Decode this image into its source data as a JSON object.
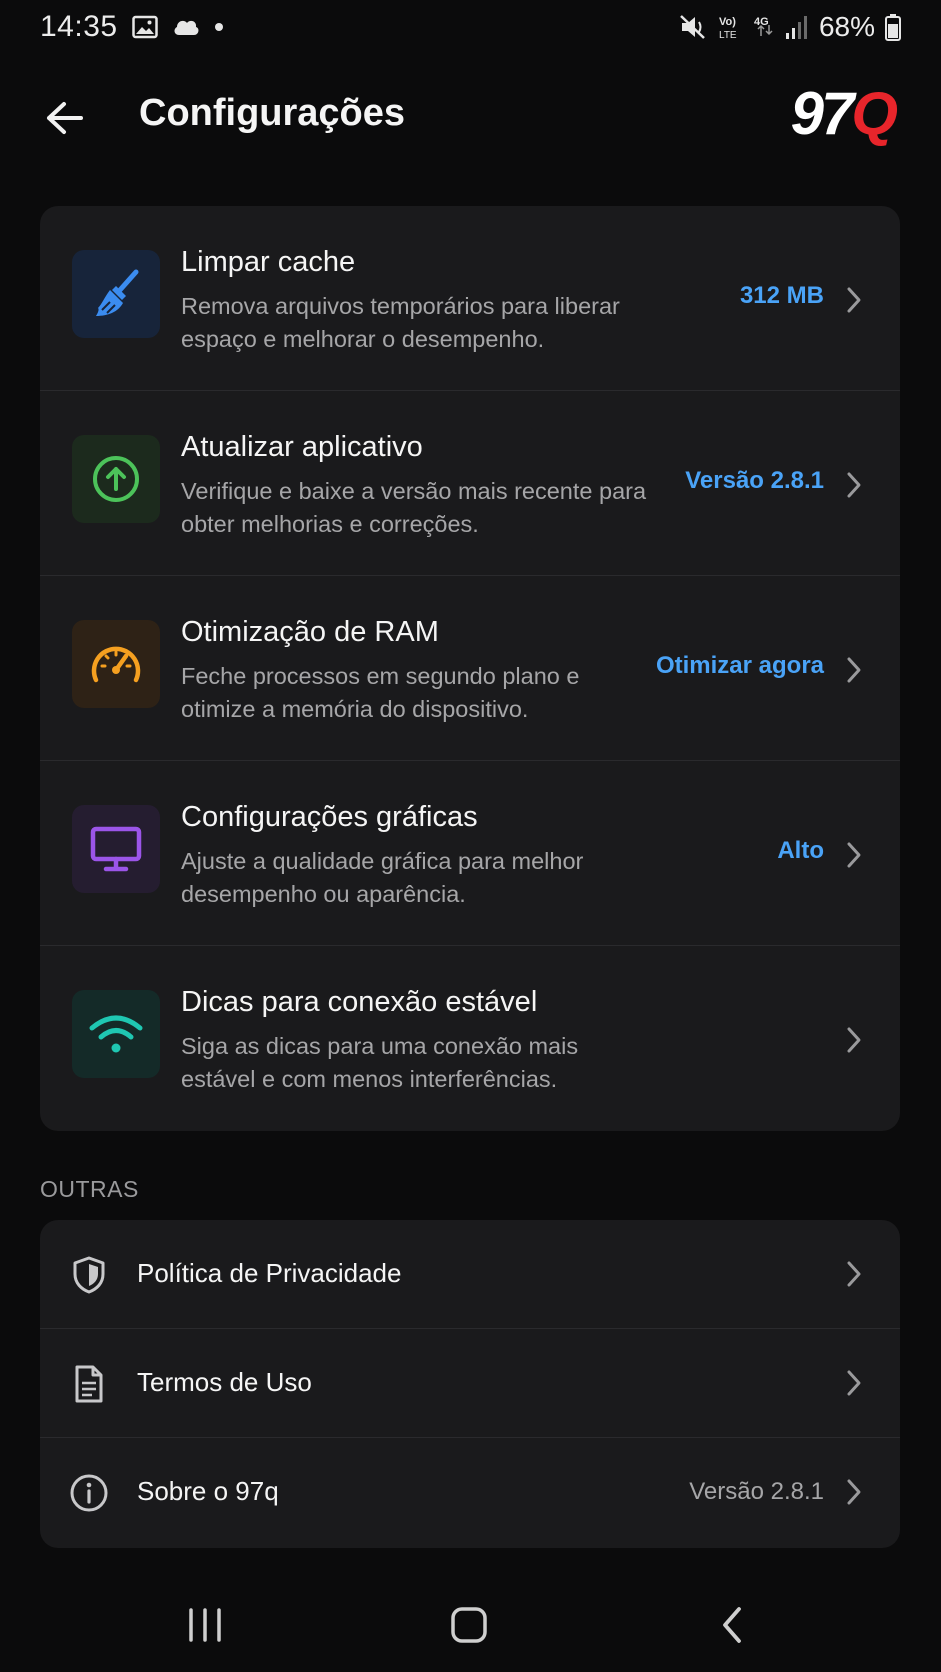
{
  "status_bar": {
    "time": "14:35",
    "battery": "68%"
  },
  "header": {
    "title": "Configurações",
    "logo_number": "97",
    "logo_letter": "Q"
  },
  "settings": [
    {
      "title": "Limpar cache",
      "description": "Remova arquivos temporários para liberar espaço e melhorar o desempenho.",
      "value": "312 MB",
      "icon": "broom-icon",
      "accent": "#3b8cf0"
    },
    {
      "title": "Atualizar aplicativo",
      "description": "Verifique e baixe a versão mais recente para obter melhorias e correções.",
      "value": "Versão 2.8.1",
      "icon": "upload-circle-icon",
      "accent": "#4cc35a"
    },
    {
      "title": "Otimização de RAM",
      "description": "Feche processos em segundo plano e otimize a memória do dispositivo.",
      "value": "Otimizar agora",
      "icon": "speedometer-icon",
      "accent": "#f5a020"
    },
    {
      "title": "Configurações gráficas",
      "description": "Ajuste a qualidade gráfica para melhor desempenho ou aparência.",
      "value": "Alto",
      "icon": "monitor-icon",
      "accent": "#9b55e8"
    },
    {
      "title": "Dicas para conexão estável",
      "description": "Siga as dicas para uma conexão mais estável e com menos interferências.",
      "value": "",
      "icon": "wifi-icon",
      "accent": "#1fc7b2"
    }
  ],
  "other_section": {
    "label": "OUTRAS",
    "items": [
      {
        "label": "Política de Privacidade",
        "value": "",
        "icon": "shield-icon"
      },
      {
        "label": "Termos de Uso",
        "value": "",
        "icon": "document-icon"
      },
      {
        "label": "Sobre o 97q",
        "value": "Versão 2.8.1",
        "icon": "info-icon"
      }
    ]
  },
  "colors": {
    "background": "#0b0b0c",
    "card": "#1a1a1c",
    "value_blue": "#4aa3f7",
    "logo_red": "#e8252b"
  }
}
